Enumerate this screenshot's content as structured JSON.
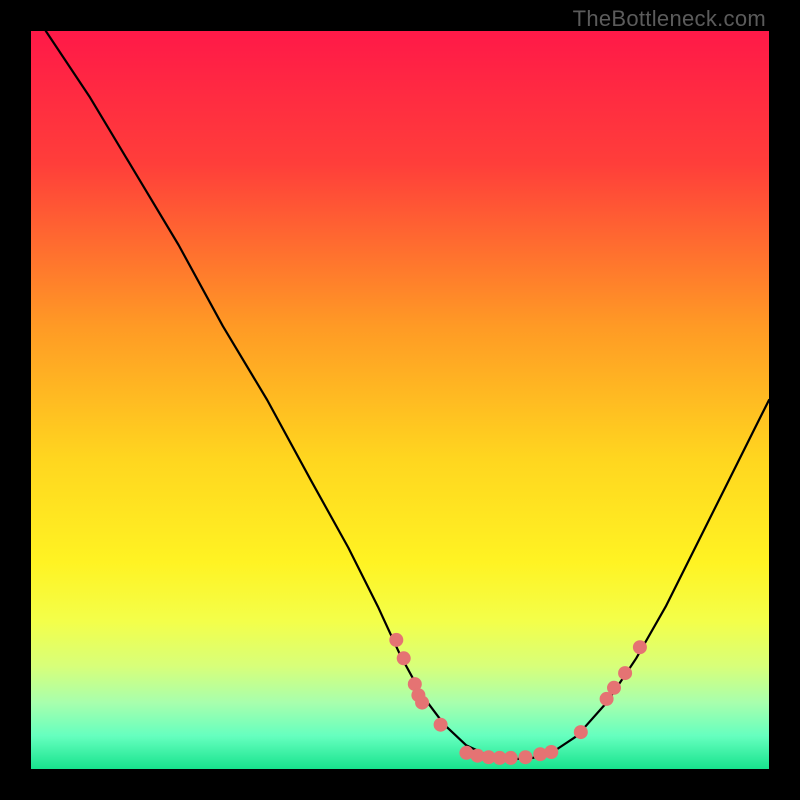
{
  "watermark": "TheBottleneck.com",
  "chart_data": {
    "type": "line",
    "title": "",
    "xlabel": "",
    "ylabel": "",
    "xlim": [
      0,
      100
    ],
    "ylim": [
      0,
      100
    ],
    "grid": false,
    "legend": false,
    "gradient_stops": [
      {
        "offset": 0.0,
        "color": "#ff1948"
      },
      {
        "offset": 0.18,
        "color": "#ff3e3a"
      },
      {
        "offset": 0.4,
        "color": "#ff9a25"
      },
      {
        "offset": 0.58,
        "color": "#ffd61f"
      },
      {
        "offset": 0.72,
        "color": "#fff323"
      },
      {
        "offset": 0.8,
        "color": "#f3ff4a"
      },
      {
        "offset": 0.86,
        "color": "#d8ff79"
      },
      {
        "offset": 0.91,
        "color": "#a8ffad"
      },
      {
        "offset": 0.955,
        "color": "#66ffbf"
      },
      {
        "offset": 1.0,
        "color": "#17e38d"
      }
    ],
    "curve_points": [
      {
        "x": 2.0,
        "y": 100.0
      },
      {
        "x": 8.0,
        "y": 91.0
      },
      {
        "x": 14.0,
        "y": 81.0
      },
      {
        "x": 20.0,
        "y": 71.0
      },
      {
        "x": 26.0,
        "y": 60.0
      },
      {
        "x": 32.0,
        "y": 50.0
      },
      {
        "x": 38.0,
        "y": 39.0
      },
      {
        "x": 43.0,
        "y": 30.0
      },
      {
        "x": 47.0,
        "y": 22.0
      },
      {
        "x": 50.0,
        "y": 15.5
      },
      {
        "x": 53.0,
        "y": 10.0
      },
      {
        "x": 56.0,
        "y": 6.0
      },
      {
        "x": 59.0,
        "y": 3.2
      },
      {
        "x": 62.0,
        "y": 1.8
      },
      {
        "x": 65.0,
        "y": 1.3
      },
      {
        "x": 68.0,
        "y": 1.5
      },
      {
        "x": 71.0,
        "y": 2.5
      },
      {
        "x": 74.0,
        "y": 4.5
      },
      {
        "x": 78.0,
        "y": 9.0
      },
      {
        "x": 82.0,
        "y": 15.0
      },
      {
        "x": 86.0,
        "y": 22.0
      },
      {
        "x": 90.0,
        "y": 30.0
      },
      {
        "x": 94.0,
        "y": 38.0
      },
      {
        "x": 98.0,
        "y": 46.0
      },
      {
        "x": 100.0,
        "y": 50.0
      }
    ],
    "scatter_points": [
      {
        "x": 49.5,
        "y": 17.5
      },
      {
        "x": 50.5,
        "y": 15.0
      },
      {
        "x": 52.0,
        "y": 11.5
      },
      {
        "x": 52.5,
        "y": 10.0
      },
      {
        "x": 53.0,
        "y": 9.0
      },
      {
        "x": 55.5,
        "y": 6.0
      },
      {
        "x": 59.0,
        "y": 2.2
      },
      {
        "x": 60.5,
        "y": 1.8
      },
      {
        "x": 62.0,
        "y": 1.6
      },
      {
        "x": 63.5,
        "y": 1.5
      },
      {
        "x": 65.0,
        "y": 1.5
      },
      {
        "x": 67.0,
        "y": 1.6
      },
      {
        "x": 69.0,
        "y": 2.0
      },
      {
        "x": 70.5,
        "y": 2.3
      },
      {
        "x": 74.5,
        "y": 5.0
      },
      {
        "x": 78.0,
        "y": 9.5
      },
      {
        "x": 79.0,
        "y": 11.0
      },
      {
        "x": 80.5,
        "y": 13.0
      },
      {
        "x": 82.5,
        "y": 16.5
      }
    ],
    "dot_color": "#e57373",
    "curve_color": "#000000",
    "dot_radius_px": 7
  }
}
